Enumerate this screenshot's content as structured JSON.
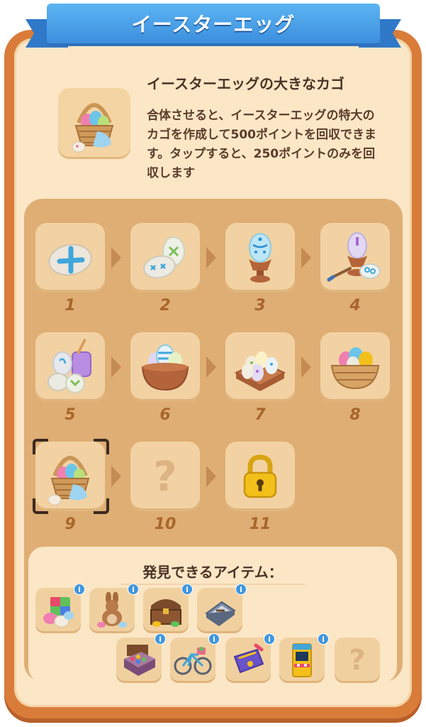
{
  "header": {
    "title": "イースターエッグ"
  },
  "item": {
    "name": "イースターエッグの大きなカゴ",
    "description": "合体させると、イースターエッグの特大のカゴを作成して500ポイントを回収できます。タップすると、250ポイントのみを回収します",
    "icon": "egg-basket-large-icon"
  },
  "chain": [
    {
      "level": "1",
      "icon": "painted-egg-icon"
    },
    {
      "level": "2",
      "icon": "two-eggs-icon"
    },
    {
      "level": "3",
      "icon": "egg-cup-icon"
    },
    {
      "level": "4",
      "icon": "egg-with-brush-icon"
    },
    {
      "level": "5",
      "icon": "eggs-with-paint-jar-icon"
    },
    {
      "level": "6",
      "icon": "egg-bowl-icon"
    },
    {
      "level": "7",
      "icon": "egg-tray-icon"
    },
    {
      "level": "8",
      "icon": "egg-basket-icon"
    },
    {
      "level": "9",
      "icon": "egg-basket-large-icon",
      "selected": true
    },
    {
      "level": "10",
      "icon": "unknown-question-icon",
      "unknown_glyph": "?"
    },
    {
      "level": "11",
      "icon": "padlock-icon",
      "locked": true
    }
  ],
  "discoverable": {
    "title": "発見できるアイテム：",
    "info_glyph": "i",
    "unknown_glyph": "?",
    "items": [
      {
        "icon": "gift-box-eggs-icon"
      },
      {
        "icon": "bunny-plush-icon"
      },
      {
        "icon": "treasure-chest-icon"
      },
      {
        "icon": "tool-case-icon"
      },
      {
        "icon": "paint-set-icon"
      },
      {
        "icon": "bicycle-icon"
      },
      {
        "icon": "purple-bag-icon"
      },
      {
        "icon": "arcade-machine-icon"
      },
      {
        "icon": "unknown-question-icon"
      }
    ]
  },
  "colors": {
    "ribbon": "#3c8fdd",
    "panel": "#d97c3a",
    "panel_inner": "#fbe6c6",
    "chain_panel": "#dfae74",
    "tile": "#f2d2a3",
    "number": "#a8662c",
    "lock": "#f3c01a"
  }
}
